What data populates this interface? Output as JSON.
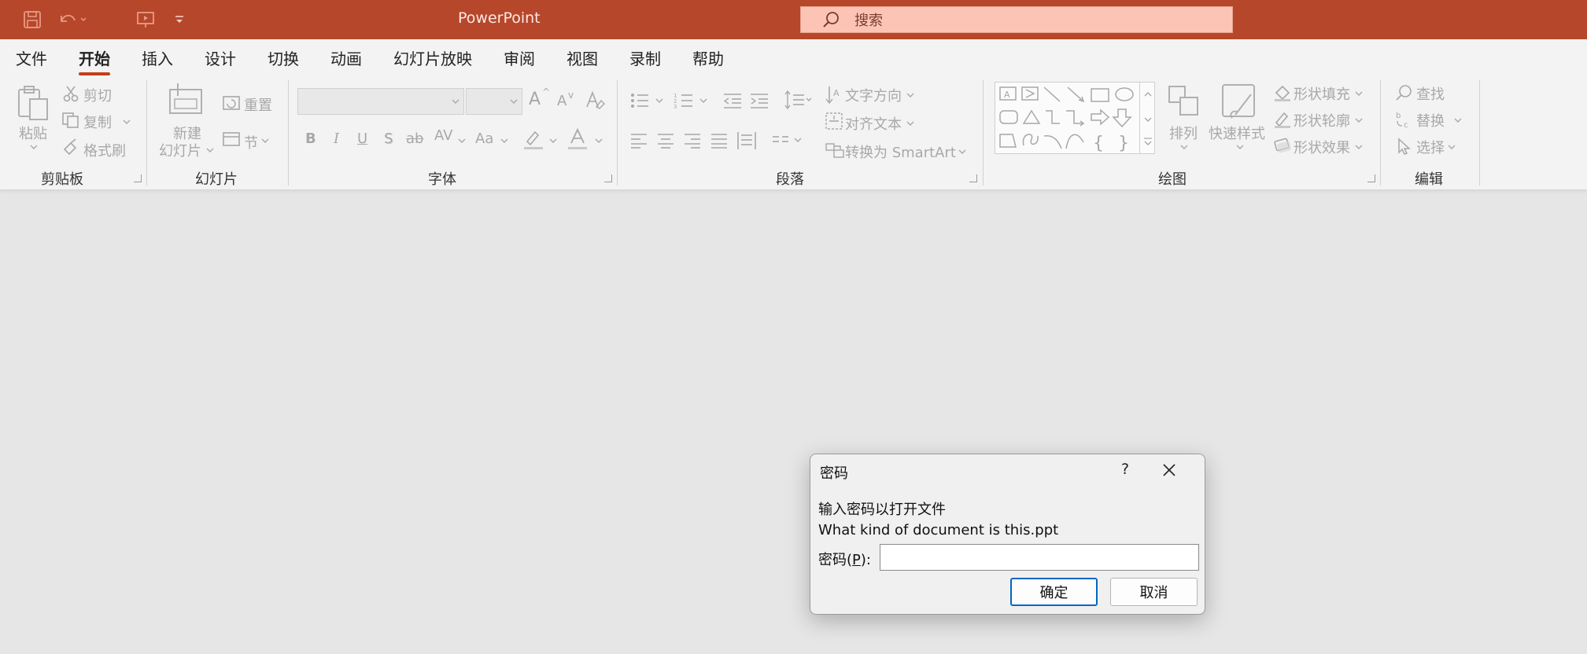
{
  "titlebar": {
    "app_title": "PowerPoint",
    "search_placeholder": "搜索",
    "accent": "#b7472a"
  },
  "menu": {
    "items": [
      {
        "label": "文件"
      },
      {
        "label": "开始",
        "active": true
      },
      {
        "label": "插入"
      },
      {
        "label": "设计"
      },
      {
        "label": "切换"
      },
      {
        "label": "动画"
      },
      {
        "label": "幻灯片放映"
      },
      {
        "label": "审阅"
      },
      {
        "label": "视图"
      },
      {
        "label": "录制"
      },
      {
        "label": "帮助"
      }
    ]
  },
  "ribbon": {
    "clipboard": {
      "group": "剪贴板",
      "paste": "粘贴",
      "cut": "剪切",
      "copy": "复制",
      "format_painter": "格式刷"
    },
    "slides": {
      "group": "幻灯片",
      "new_slide_1": "新建",
      "new_slide_2": "幻灯片",
      "reset": "重置",
      "section": "节"
    },
    "font": {
      "group": "字体",
      "bold": "B",
      "italic": "I",
      "underline": "U",
      "shadow": "S",
      "strike": "ab",
      "spacing": "AV",
      "case": "Aa",
      "grow": "A",
      "shrink": "A"
    },
    "paragraph": {
      "group": "段落",
      "text_direction": "文字方向",
      "align_text": "对齐文本",
      "smartart": "转换为 SmartArt"
    },
    "drawing": {
      "group": "绘图",
      "arrange": "排列",
      "quick_styles": "快速样式",
      "shape_fill": "形状填充",
      "shape_outline": "形状轮廓",
      "shape_effects": "形状效果"
    },
    "editing": {
      "group": "编辑",
      "find": "查找",
      "replace": "替换",
      "select": "选择"
    }
  },
  "dialog": {
    "title": "密码",
    "help": "?",
    "message": "输入密码以打开文件",
    "filename": "What kind of document is this.ppt",
    "password_label_pre": "密码(",
    "password_label_key": "P",
    "password_label_post": "):",
    "password_value": "",
    "ok": "确定",
    "cancel": "取消"
  }
}
